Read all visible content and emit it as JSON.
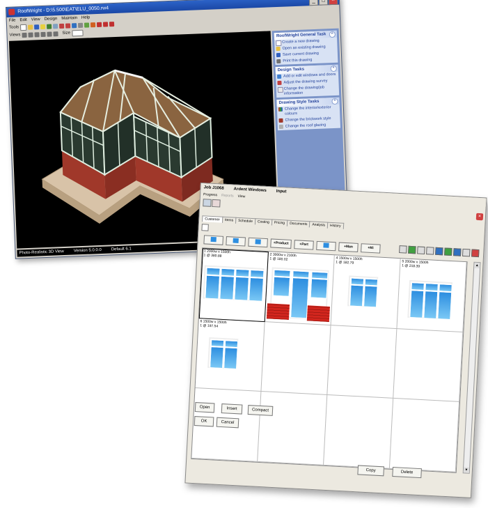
{
  "back_window": {
    "title": "RoofWright - D:\\5.500\\EAT\\ELU_0050.rw4",
    "menus": [
      "File",
      "Edit",
      "View",
      "Design",
      "Maintain",
      "Help"
    ],
    "tools_label": "Tools",
    "views_label": "Views",
    "size_label": "Size",
    "status": {
      "mode": "Photo-Realistic 3D View",
      "version": "Version 5.0.0.0",
      "default": "Default 6.1"
    },
    "task_pane": [
      {
        "heading": "RoofWright General Task",
        "items": [
          "Create a new drawing",
          "Open an existing drawing",
          "Save current drawing",
          "Print this drawing"
        ]
      },
      {
        "heading": "Design Tasks",
        "items": [
          "Add or edit windows and doors",
          "Adjust the drawing survey",
          "Change the drawing/job information"
        ]
      },
      {
        "heading": "Drawing Style Tasks",
        "items": [
          "Change the interior/exterior colours",
          "Change the brickwork style",
          "Change the roof glazing"
        ]
      }
    ]
  },
  "front_window": {
    "title": {
      "job": "Job  J1068",
      "customer": "Ardent Windows",
      "mode": "Input"
    },
    "menus": [
      "Progress",
      "Reports",
      "View"
    ],
    "tabs": [
      "Customer",
      "Items",
      "Schedule",
      "Costing",
      "Pricing",
      "Documents",
      "Analysis",
      "History"
    ],
    "toolbar_buttons": [
      "",
      "",
      "",
      "+Product",
      "+Part",
      "",
      "+Man",
      "+Mi"
    ],
    "items": [
      {
        "label": "1  2000w x 1500h",
        "sub": "1 @ 380.88"
      },
      {
        "label": "2  3000w x 2100h",
        "sub": "1 @ 180.02"
      },
      {
        "label": "4  1500w x 1500h",
        "sub": "1 @ 182.79"
      },
      {
        "label": "5  2000w x 1500h",
        "sub": "1 @ 218.39"
      },
      {
        "label": "6  1500w x 1500h",
        "sub": "1 @ 197.54"
      }
    ],
    "bottom_buttons": {
      "open": "Open",
      "insert": "Insert",
      "compact": "Compact",
      "ok": "OK",
      "cancel": "Cancel",
      "copy": "Copy",
      "delete": "Delete"
    }
  },
  "colors": {
    "xp_title": "#1b48a6",
    "task_pane": "#7b94c8",
    "glass": "#2d8ee0",
    "brick": "#d3261e",
    "close": "#d04040"
  }
}
